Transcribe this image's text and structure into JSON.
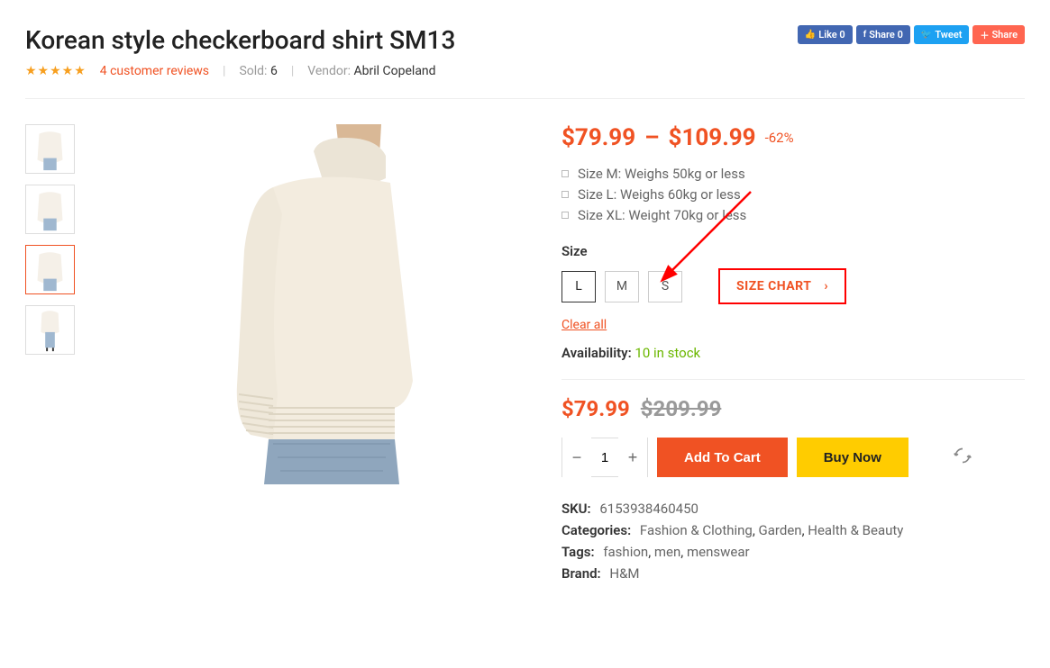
{
  "product": {
    "title": "Korean style checkerboard shirt SM13",
    "reviews_count": "4 customer reviews",
    "sold_label": "Sold:",
    "sold_count": "6",
    "vendor_label": "Vendor:",
    "vendor_name": "Abril Copeland"
  },
  "social": {
    "like": "Like 0",
    "fb_share": "Share 0",
    "tweet": "Tweet",
    "share": "Share"
  },
  "price": {
    "min": "$79.99",
    "dash": "–",
    "max": "$109.99",
    "discount": "-62%"
  },
  "bullets": [
    "Size M: Weighs 50kg or less",
    "Size L: Weighs 60kg or less",
    "Size XL: Weight 70kg or less"
  ],
  "size": {
    "label": "Size",
    "options": [
      "L",
      "M",
      "S"
    ],
    "chart_label": "SIZE CHART",
    "clear": "Clear all"
  },
  "availability": {
    "label": "Availability:",
    "value": "10 in stock"
  },
  "final": {
    "sale": "$79.99",
    "orig": "$209.99"
  },
  "actions": {
    "qty": "1",
    "add": "Add To Cart",
    "buy": "Buy Now"
  },
  "meta": {
    "sku_label": "SKU:",
    "sku": "6153938460450",
    "cat_label": "Categories:",
    "categories": [
      "Fashion & Clothing",
      "Garden",
      "Health & Beauty"
    ],
    "tag_label": "Tags:",
    "tags": [
      "fashion",
      "men",
      "menswear"
    ],
    "brand_label": "Brand:",
    "brand": "H&M"
  }
}
